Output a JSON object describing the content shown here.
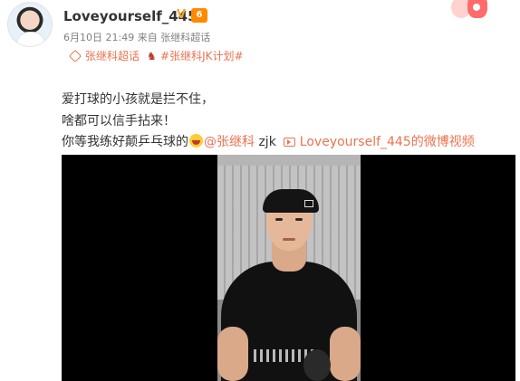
{
  "post": {
    "username": "Loveyourself_445",
    "vip_label": "6",
    "meta": {
      "date": "6月10日",
      "time": "21:49",
      "source_prefix": "来自",
      "source": "张继科超话"
    },
    "tags": [
      {
        "label": "张继科超话",
        "icon": "diamond-icon"
      },
      {
        "label": "#张继科JK计划#",
        "icon": "figure-icon"
      }
    ],
    "text": {
      "line1": "爱打球的小孩就是拦不住，",
      "line2": "啥都可以信手拈来！",
      "line3_prefix": "你等我练好颠乒乓球的",
      "mention": "@张继科",
      "mention_suffix": " zjk",
      "video_link": "Loveyourself_445的微博视频"
    }
  },
  "colors": {
    "accent": "#eb7350",
    "text": "#333333",
    "meta": "#808080",
    "player_bg": "#000000"
  }
}
